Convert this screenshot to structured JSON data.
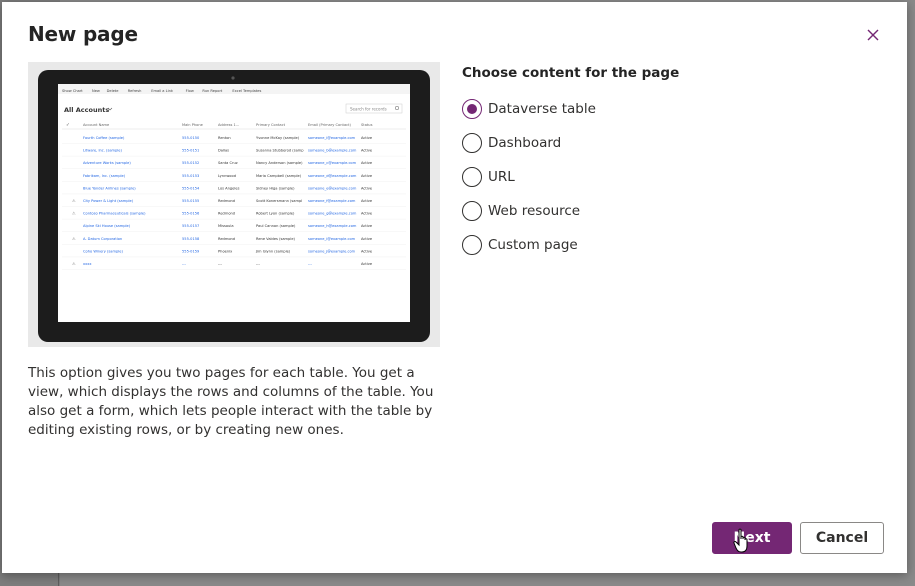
{
  "dialog": {
    "title": "New page",
    "close_icon": "close-icon"
  },
  "content": {
    "choose_label": "Choose content for the page",
    "options": [
      {
        "label": "Dataverse table",
        "selected": true
      },
      {
        "label": "Dashboard",
        "selected": false
      },
      {
        "label": "URL",
        "selected": false
      },
      {
        "label": "Web resource",
        "selected": false
      },
      {
        "label": "Custom page",
        "selected": false
      }
    ],
    "description": "This option gives you two pages for each table. You get a view, which displays the rows and columns of the table. You also get a form, which lets people interact with the table by editing existing rows, or by creating new ones."
  },
  "preview": {
    "toolbar": [
      "Show Chart",
      "New",
      "Delete",
      "Refresh",
      "Email a Link",
      "Flow",
      "Run Report",
      "Excel Templates"
    ],
    "view_title": "All Accounts",
    "search_placeholder": "Search for records",
    "columns": [
      "Account Name",
      "Main Phone",
      "Address 1...",
      "Primary Contact",
      "Email (Primary Contact)",
      "Status"
    ],
    "rows": [
      [
        "Fourth Coffee (sample)",
        "555-0150",
        "Renton",
        "Yvonne McKay (sample)",
        "someone_i@example.com",
        "Active"
      ],
      [
        "Litware, Inc. (sample)",
        "555-0151",
        "Dallas",
        "Susanna Stubberod (samp",
        "someone_b@example.com",
        "Active"
      ],
      [
        "Adventure Works (sample)",
        "555-0152",
        "Santa Cruz",
        "Nancy Anderson (sample)",
        "someone_c@example.com",
        "Active"
      ],
      [
        "Fabrikam, Inc. (sample)",
        "555-0153",
        "Lynnwood",
        "Maria Campbell (sample)",
        "someone_d@example.com",
        "Active"
      ],
      [
        "Blue Yonder Airlines (sample)",
        "555-0154",
        "Los Angeles",
        "Sidney Higa (sample)",
        "someone_e@example.com",
        "Active"
      ],
      [
        "City Power & Light (sample)",
        "555-0155",
        "Redmond",
        "Scott Konersmann (sampl",
        "someone_f@example.com",
        "Active"
      ],
      [
        "Contoso Pharmaceuticals (sample)",
        "555-0156",
        "Redmond",
        "Robert Lyon (sample)",
        "someone_g@example.com",
        "Active"
      ],
      [
        "Alpine Ski House (sample)",
        "555-0157",
        "Missoula",
        "Paul Cannon (sample)",
        "someone_h@example.com",
        "Active"
      ],
      [
        "A. Datum Corporation",
        "555-0158",
        "Redmond",
        "Rene Valdes (sample)",
        "someone_i@example.com",
        "Active"
      ],
      [
        "Coho Winery (sample)",
        "555-0159",
        "Phoenix",
        "Jim Glynn (sample)",
        "someone_j@example.com",
        "Active"
      ],
      [
        "xxxx",
        "---",
        "---",
        "---",
        "---",
        "Active"
      ]
    ],
    "warn_rows": [
      5,
      6,
      8,
      10
    ]
  },
  "footer": {
    "next_label": "Next",
    "cancel_label": "Cancel"
  },
  "colors": {
    "accent": "#742774",
    "link": "#2266e3"
  }
}
